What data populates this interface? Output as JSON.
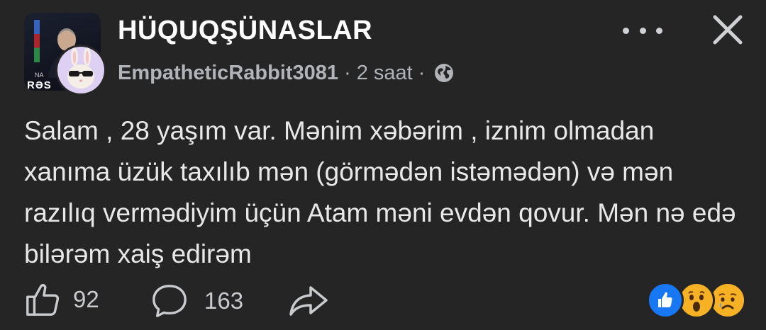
{
  "header": {
    "group_name": "HÜQUQŞÜNASLAR",
    "group_avatar_label": "RƏS",
    "group_avatar_label_small": "NA",
    "username": "EmpatheticRabbit3081",
    "separator": "·",
    "time": "2 saat",
    "separator2": "·"
  },
  "post": {
    "text": "Salam , 28 yaşım var. Mənim xəbərim , iznim olmadan xanıma üzük taxılıb mən (görmədən istəmədən) və mən razılıq vermədiyim üçün Atam məni evdən qovur. Mən nə edə bilərəm xaiş edirəm"
  },
  "actions": {
    "like_count": "92",
    "comment_count": "163"
  },
  "icons": {
    "more": "more-dots-icon",
    "close": "close-icon",
    "privacy": "globe-icon",
    "like": "thumbs-up-icon",
    "comment": "comment-bubble-icon",
    "share": "share-arrow-icon"
  },
  "colors": {
    "background": "#252525",
    "text": "#e4e6eb",
    "secondary_text": "#b0b3b8",
    "like_blue": "#1877f2",
    "wow_yellow": "#f7b125"
  }
}
